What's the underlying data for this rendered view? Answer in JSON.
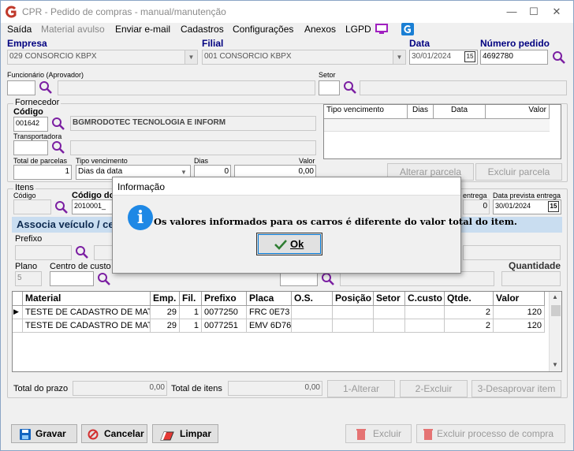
{
  "window": {
    "title": "CPR - Pedido de compras - manual/manutenção"
  },
  "menu": [
    "Saída",
    "Material avulso",
    "Enviar e-mail",
    "Cadastros",
    "Configurações",
    "Anexos",
    "LGPD"
  ],
  "header": {
    "empresa_label": "Empresa",
    "empresa_value": "029 CONSORCIO KBPX",
    "filial_label": "Filial",
    "filial_value": "001 CONSORCIO KBPX",
    "data_label": "Data",
    "data_value": "30/01/2024",
    "numero_label": "Número pedido",
    "numero_value": "4692780",
    "funcionario_label": "Funcionário (Aprovador)",
    "setor_label": "Setor"
  },
  "fornecedor": {
    "title": "Fornecedor",
    "codigo_label": "Código",
    "codigo_value": "001642",
    "nome_value": "BGMRODOTEC TECNOLOGIA E INFORM",
    "transportadora_label": "Transportadora",
    "total_parcelas_label": "Total de parcelas",
    "total_parcelas_value": "1",
    "tipo_venc_label": "Tipo vencimento",
    "tipo_venc_value": "Dias da data",
    "dias_label": "Dias",
    "dias_value": "0",
    "valor_label": "Valor",
    "valor_value": "0,00",
    "parcel_cols": [
      "Tipo vencimento",
      "Dias",
      "Data",
      "Valor"
    ],
    "alterar_parcela": "Alterar parcela",
    "excluir_parcela": "Excluir parcela"
  },
  "itens": {
    "title": "Itens",
    "codigo_label": "Código",
    "codigo_do_label": "Código do",
    "codigo_do_value": "2010001_",
    "entrega_label": "entrega",
    "entrega_value": "0",
    "data_prev_label": "Data prevista entrega",
    "data_prev_value": "30/01/2024",
    "band_title": "Associa veículo / ce",
    "prefixo_label": "Prefixo",
    "plano_label": "Plano",
    "plano_value": "5",
    "centro_label": "Centro de custo",
    "quantidade_label": "Quantidade",
    "columns": [
      "Material",
      "Emp.",
      "Fil.",
      "Prefixo",
      "Placa",
      "O.S.",
      "Posição",
      "Setor",
      "C.custo",
      "Qtde.",
      "Valor"
    ],
    "rows": [
      {
        "material": "TESTE DE CADASTRO DE MAT",
        "emp": "29",
        "fil": "1",
        "prefixo": "0077250",
        "placa": "FRC 0E73",
        "os": "",
        "posicao": "",
        "setor": "",
        "ccusto": "",
        "qtde": "2",
        "valor": "120"
      },
      {
        "material": "TESTE DE CADASTRO DE MAT",
        "emp": "29",
        "fil": "1",
        "prefixo": "0077251",
        "placa": "EMV 6D76",
        "os": "",
        "posicao": "",
        "setor": "",
        "ccusto": "",
        "qtde": "2",
        "valor": "120"
      }
    ],
    "total_prazo_label": "Total do prazo",
    "total_prazo_value": "0,00",
    "total_itens_label": "Total de itens",
    "total_itens_value": "0,00",
    "alterar_btn": "1-Alterar",
    "excluir_btn": "2-Excluir",
    "desaprovar_btn": "3-Desaprovar item"
  },
  "footer": {
    "gravar": "Gravar",
    "cancelar": "Cancelar",
    "limpar": "Limpar",
    "excluir": "Excluir",
    "excluir_processo": "Excluir processo de compra"
  },
  "dialog": {
    "title": "Informação",
    "message": "Os valores informados para os carros é diferente do valor total do item.",
    "ok": "Ok"
  },
  "colors": {
    "accent_blue": "#000080",
    "band": "#c9ddf0",
    "info_icon": "#1e88e5"
  }
}
